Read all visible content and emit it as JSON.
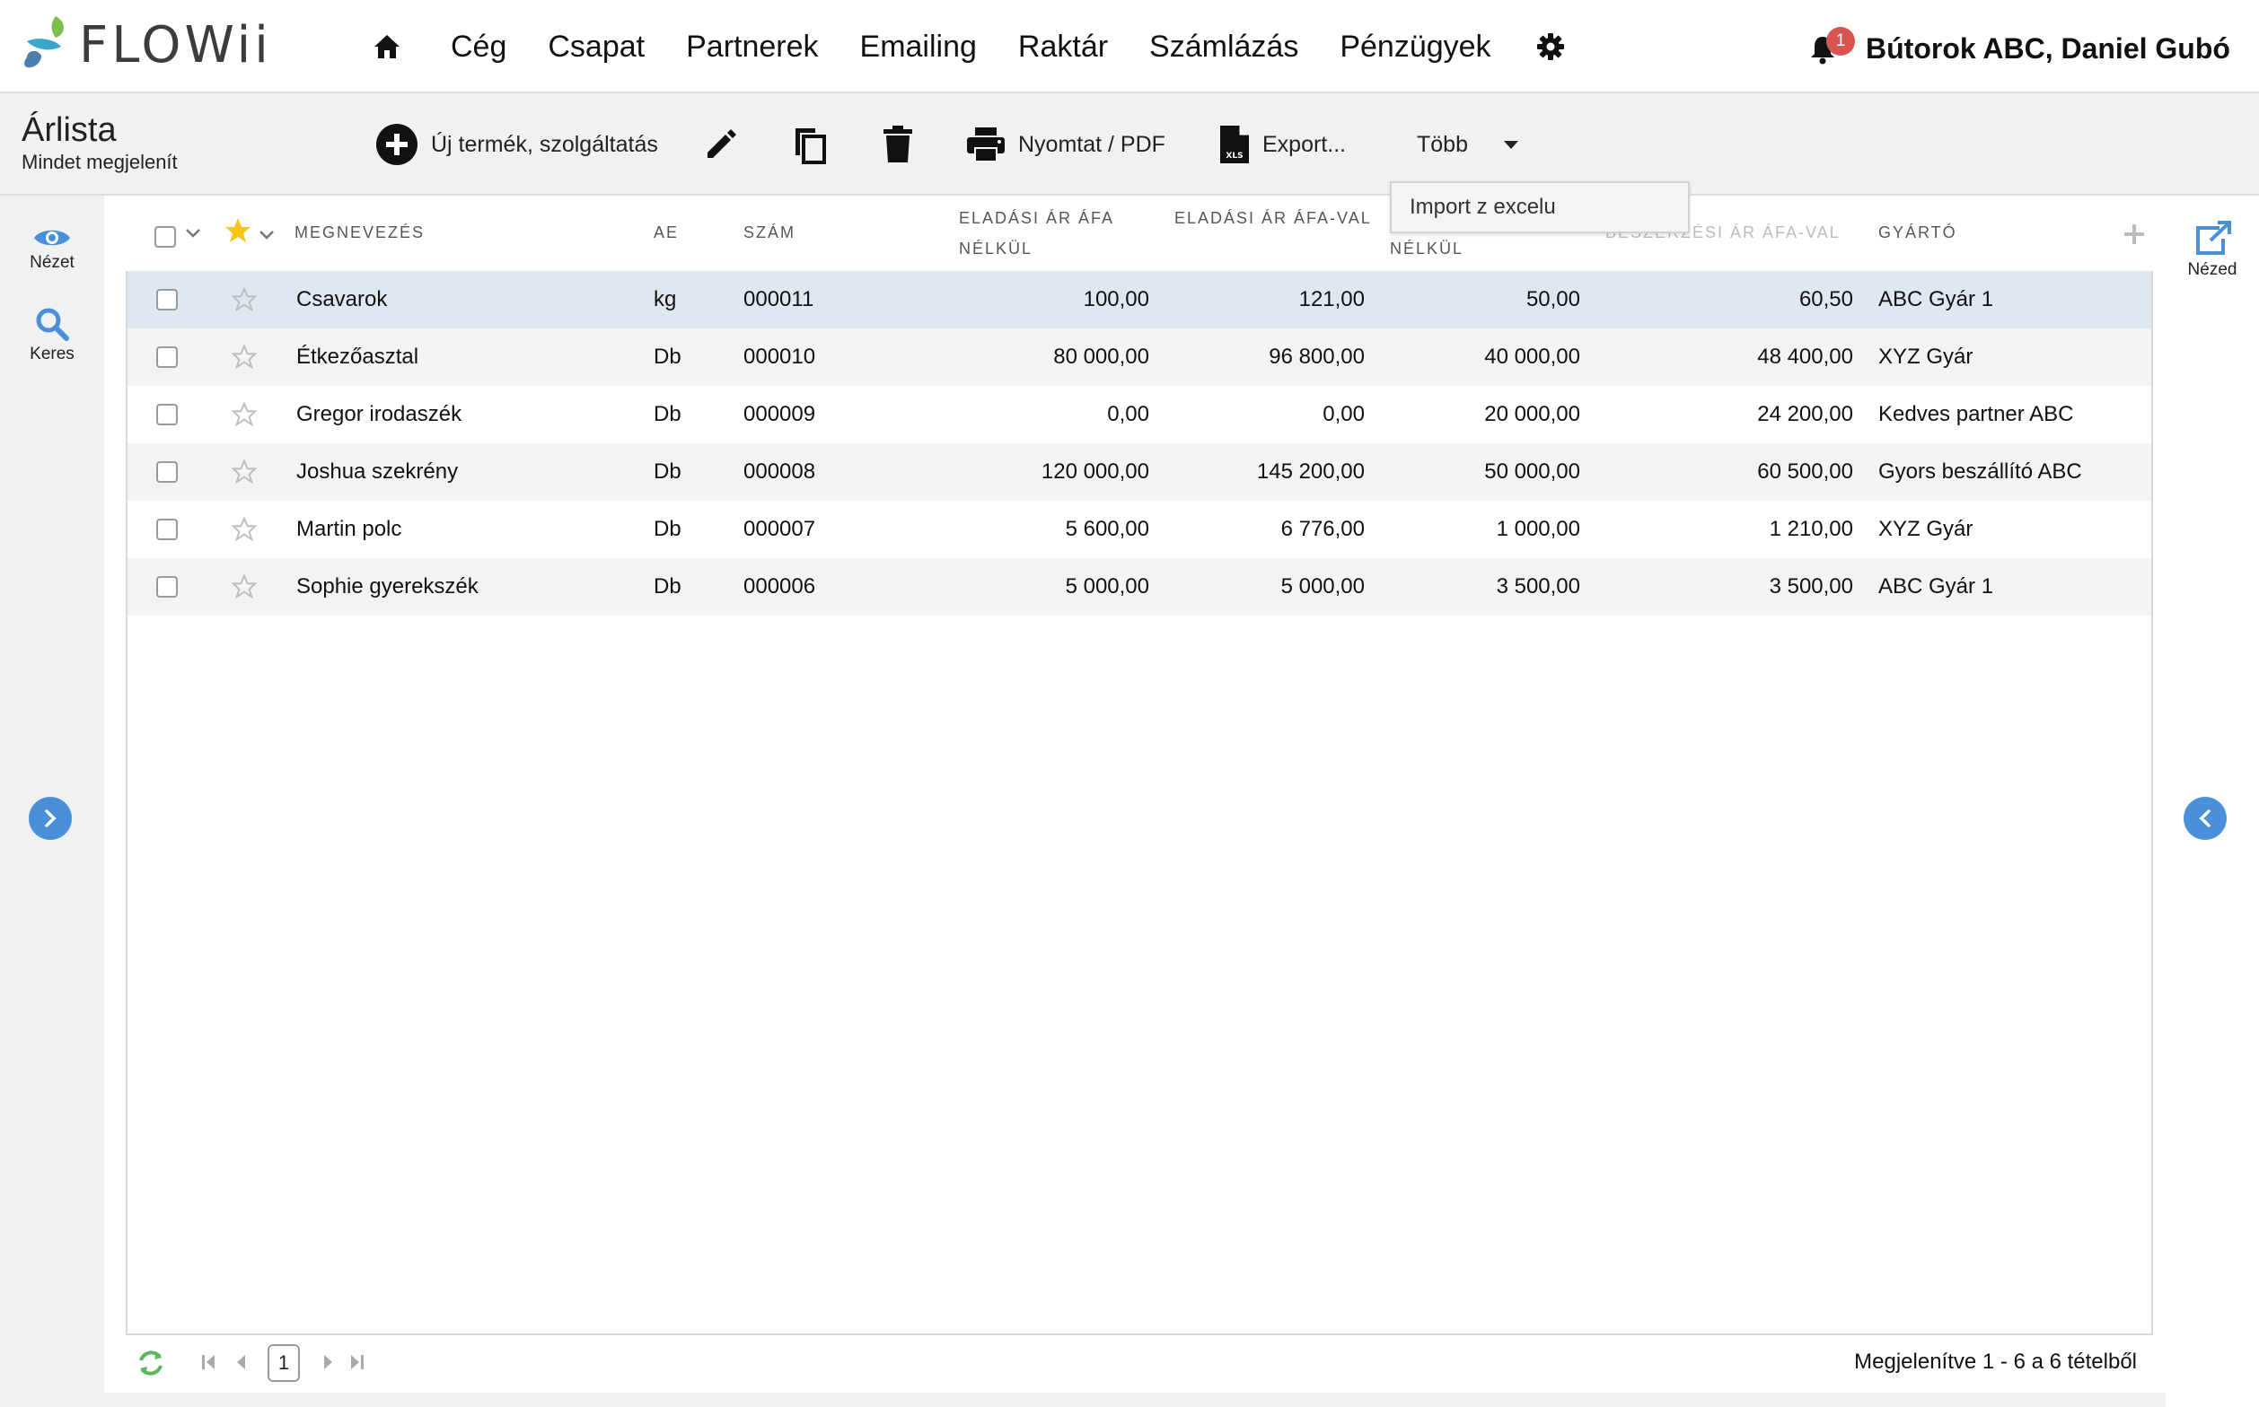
{
  "app": {
    "logo_text": "FLOWii"
  },
  "nav": {
    "items": [
      "Cég",
      "Csapat",
      "Partnerek",
      "Emailing",
      "Raktár",
      "Számlázás",
      "Pénzügyek"
    ],
    "notification_count": "1",
    "user": "Bútorok ABC, Daniel Gubó"
  },
  "page": {
    "title": "Árlista",
    "subtitle": "Mindet megjelenít"
  },
  "toolbar": {
    "new_label": "Új termék, szolgáltatás",
    "print_label": "Nyomtat / PDF",
    "export_label": "Export...",
    "more_label": "Több"
  },
  "dropdown": {
    "items": [
      "Import z excelu"
    ]
  },
  "left_rail": {
    "view_label": "Nézet",
    "search_label": "Keres"
  },
  "right_rail": {
    "open_label": "Nézed"
  },
  "table": {
    "headers": {
      "name": "Megnevezés",
      "unit": "AE",
      "number": "Szám",
      "sale_net_1": "Eladási ár áfa",
      "sale_net_2": "nélkül",
      "sale_gross": "Eladási ár áfa-val",
      "purchase_net_2": "nélkül",
      "purchase_gross": "Beszerzési ár áfa-val",
      "manufacturer": "Gyártó"
    },
    "rows": [
      {
        "name": "Csavarok",
        "unit": "kg",
        "number": "000011",
        "sale_net": "100,00",
        "sale_gross": "121,00",
        "purchase_net": "50,00",
        "purchase_gross": "60,50",
        "manufacturer": "ABC Gyár 1"
      },
      {
        "name": "Étkezőasztal",
        "unit": "Db",
        "number": "000010",
        "sale_net": "80 000,00",
        "sale_gross": "96 800,00",
        "purchase_net": "40 000,00",
        "purchase_gross": "48 400,00",
        "manufacturer": "XYZ Gyár"
      },
      {
        "name": "Gregor irodaszék",
        "unit": "Db",
        "number": "000009",
        "sale_net": "0,00",
        "sale_gross": "0,00",
        "purchase_net": "20 000,00",
        "purchase_gross": "24 200,00",
        "manufacturer": "Kedves partner ABC"
      },
      {
        "name": "Joshua szekrény",
        "unit": "Db",
        "number": "000008",
        "sale_net": "120 000,00",
        "sale_gross": "145 200,00",
        "purchase_net": "50 000,00",
        "purchase_gross": "60 500,00",
        "manufacturer": "Gyors beszállító ABC"
      },
      {
        "name": "Martin polc",
        "unit": "Db",
        "number": "000007",
        "sale_net": "5 600,00",
        "sale_gross": "6 776,00",
        "purchase_net": "1 000,00",
        "purchase_gross": "1 210,00",
        "manufacturer": "XYZ Gyár"
      },
      {
        "name": "Sophie gyerekszék",
        "unit": "Db",
        "number": "000006",
        "sale_net": "5 000,00",
        "sale_gross": "5 000,00",
        "purchase_net": "3 500,00",
        "purchase_gross": "3 500,00",
        "manufacturer": "ABC Gyár 1"
      }
    ]
  },
  "footer": {
    "page": "1",
    "status": "Megjelenítve 1 - 6 a 6 tételből"
  },
  "colors": {
    "accent": "#4a90d9",
    "star": "#f5c518",
    "badge": "#d9534f",
    "selected_row": "#dfe7f1"
  }
}
